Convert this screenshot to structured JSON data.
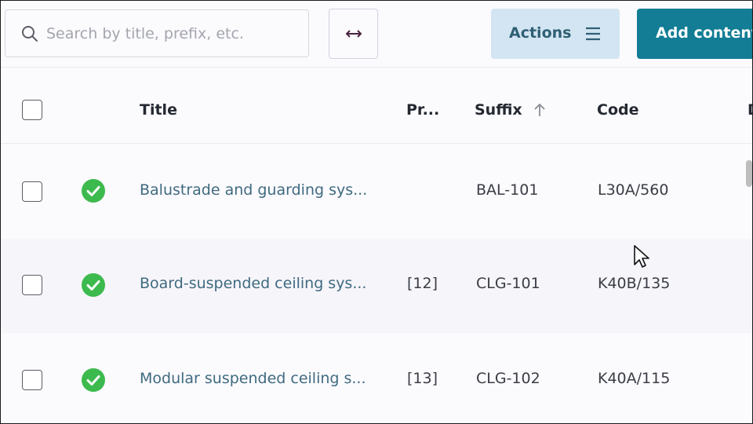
{
  "search": {
    "placeholder": "Search by title, prefix, etc.",
    "value": ""
  },
  "toolbar": {
    "resize_icon": "horizontal-resize-icon",
    "actions_label": "Actions",
    "actions_icon": "hamburger-menu-icon",
    "add_content_label": "Add content"
  },
  "table": {
    "columns": [
      "Title",
      "Pr...",
      "Suffix",
      "Code",
      "D"
    ],
    "sort": {
      "column": "Suffix",
      "direction": "ascending"
    },
    "rows": [
      {
        "status": "approved",
        "title": "Balustrade and guarding sys...",
        "prefix": "",
        "suffix": "BAL-101",
        "code": "L30A/560"
      },
      {
        "status": "approved",
        "title": "Board-suspended ceiling sys...",
        "prefix": "[12]",
        "suffix": "CLG-101",
        "code": "K40B/135"
      },
      {
        "status": "approved",
        "title": "Modular suspended ceiling s...",
        "prefix": "[13]",
        "suffix": "CLG-102",
        "code": "K40A/115"
      }
    ]
  },
  "colors": {
    "primary": "#127d95",
    "secondary": "#d3e5f2",
    "success": "#3dba4e",
    "link": "#3f6a80"
  }
}
